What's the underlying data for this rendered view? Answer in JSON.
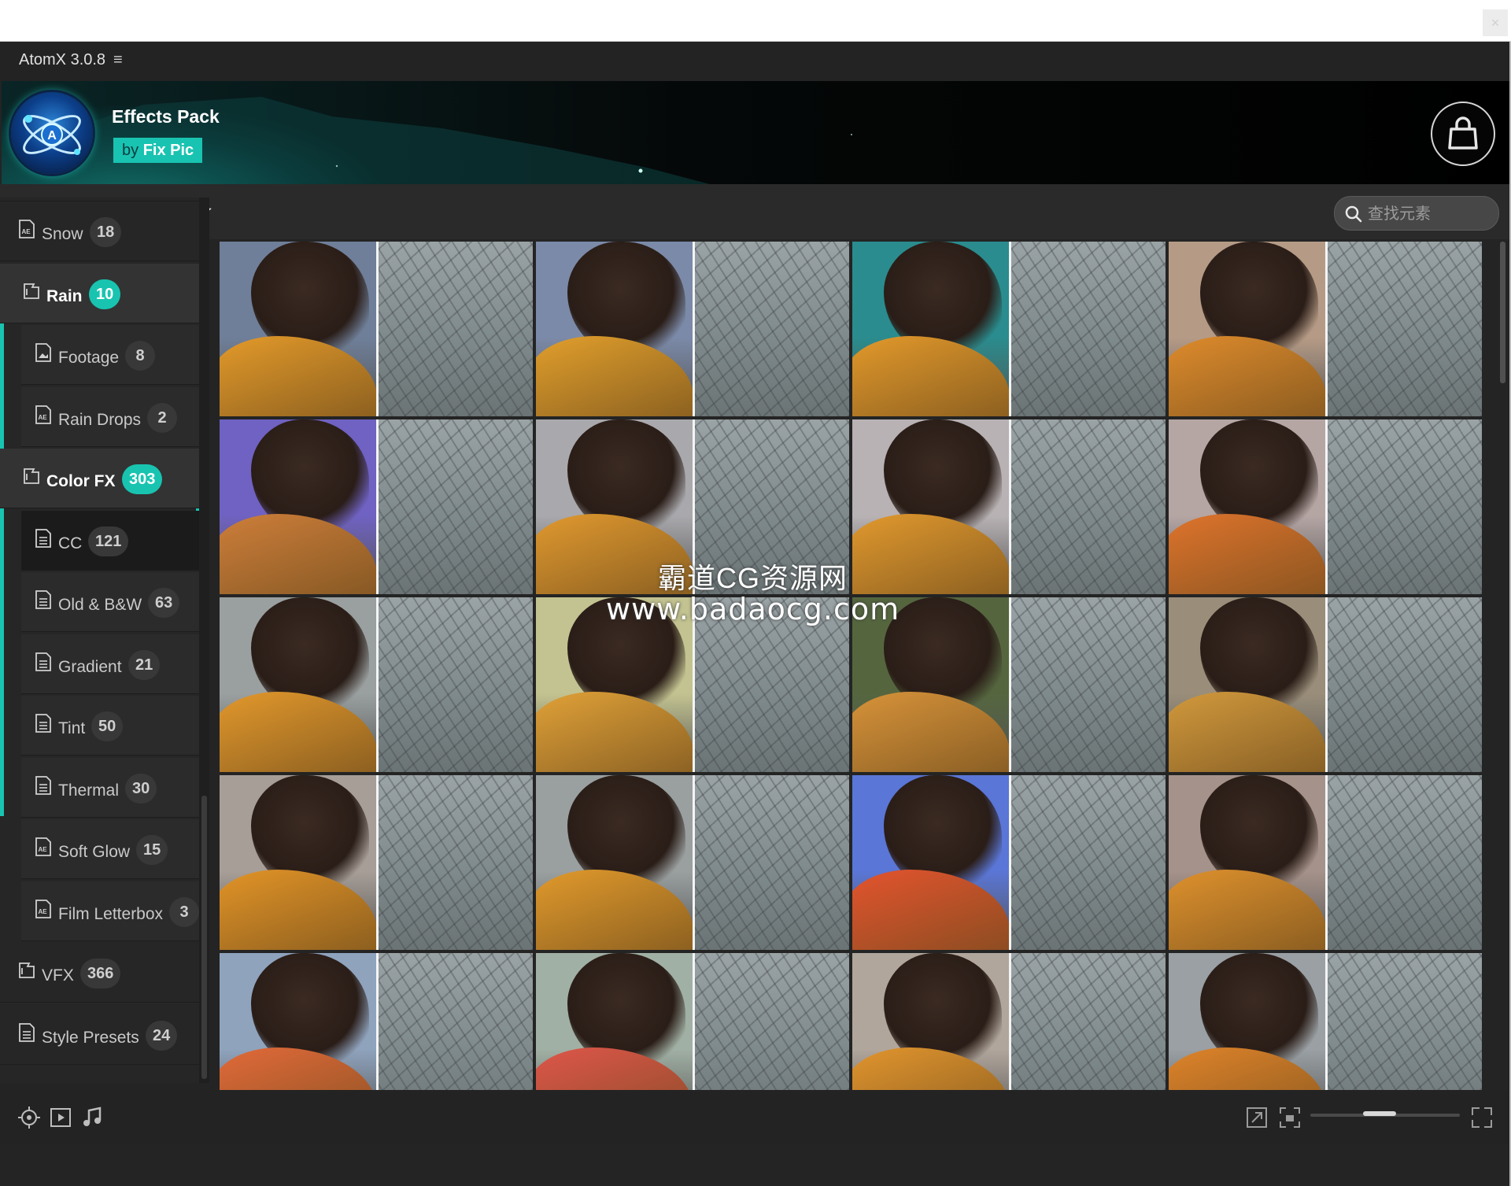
{
  "window": {
    "close_glyph": "×"
  },
  "app": {
    "title": "AtomX 3.0.8",
    "menu_glyph": "≡"
  },
  "banner": {
    "title": "Effects Pack",
    "by_prefix": "by",
    "by_name": "Fix Pic"
  },
  "toolbar": {
    "icons": [
      "sliders-icon",
      "list-icon",
      "play-file-icon",
      "star-icon"
    ],
    "search_placeholder": "查找元素"
  },
  "sidebar": {
    "items": [
      {
        "label": "Snow",
        "count": "18",
        "icon": "ae-file-icon",
        "level": 0
      },
      {
        "label": "Rain",
        "count": "10",
        "icon": "folder-icon",
        "level": 0,
        "expanded": true
      },
      {
        "label": "Footage",
        "count": "8",
        "icon": "image-file-icon",
        "level": 1
      },
      {
        "label": "Rain Drops",
        "count": "2",
        "icon": "ae-file-icon",
        "level": 1
      },
      {
        "label": "Color FX",
        "count": "303",
        "icon": "folder-icon",
        "level": 0,
        "expanded": true
      },
      {
        "label": "CC",
        "count": "121",
        "icon": "doc-file-icon",
        "level": 1,
        "selected": true
      },
      {
        "label": "Old & B&W",
        "count": "63",
        "icon": "doc-file-icon",
        "level": 1
      },
      {
        "label": "Gradient",
        "count": "21",
        "icon": "doc-file-icon",
        "level": 1
      },
      {
        "label": "Tint",
        "count": "50",
        "icon": "doc-file-icon",
        "level": 1
      },
      {
        "label": "Thermal",
        "count": "30",
        "icon": "doc-file-icon",
        "level": 1
      },
      {
        "label": "Soft Glow",
        "count": "15",
        "icon": "ae-file-icon",
        "level": 1
      },
      {
        "label": "Film Letterbox",
        "count": "3",
        "icon": "ae-file-icon",
        "level": 1
      },
      {
        "label": "VFX",
        "count": "366",
        "icon": "folder-icon",
        "level": 0
      },
      {
        "label": "Style Presets",
        "count": "24",
        "icon": "doc-file-icon",
        "level": 0
      }
    ]
  },
  "grid": {
    "thumbnails": [
      [
        "#6f7f99",
        "#e59b2a"
      ],
      [
        "#7b8aa8",
        "#e3a02c"
      ],
      [
        "#2a8c8e",
        "#e49a2b"
      ],
      [
        "#b59b86",
        "#e08c2c"
      ],
      [
        "#6f62c2",
        "#cf7f3a"
      ],
      [
        "#a9a9ad",
        "#e29a2f"
      ],
      [
        "#b8b2b4",
        "#e39a2e"
      ],
      [
        "#b5a6a4",
        "#e0742c"
      ],
      [
        "#9aa0a0",
        "#e4992c"
      ],
      [
        "#c3c391",
        "#e2a238"
      ],
      [
        "#55663f",
        "#d9943a"
      ],
      [
        "#9a8e7a",
        "#d39a3d"
      ],
      [
        "#a79e97",
        "#e49527"
      ],
      [
        "#9aa0a0",
        "#e39b2c"
      ],
      [
        "#5a76d6",
        "#e5542e"
      ],
      [
        "#a5928a",
        "#e0922d"
      ],
      [
        "#8fa3bd",
        "#e46a3a"
      ],
      [
        "#a1b0a4",
        "#e0564a"
      ],
      [
        "#b1a69c",
        "#e3962e"
      ],
      [
        "#9aa0a4",
        "#e0842a"
      ]
    ],
    "watermark_line1": "霸道CG资源网",
    "watermark_line2": "www.badaocg.com"
  },
  "footer": {
    "left_icons": [
      "target-icon",
      "play-box-icon",
      "music-note-icon"
    ],
    "right_icons": [
      "expand-icon",
      "fit-icon",
      "fullscreen-icon"
    ],
    "zoom_fraction": 0.45
  }
}
